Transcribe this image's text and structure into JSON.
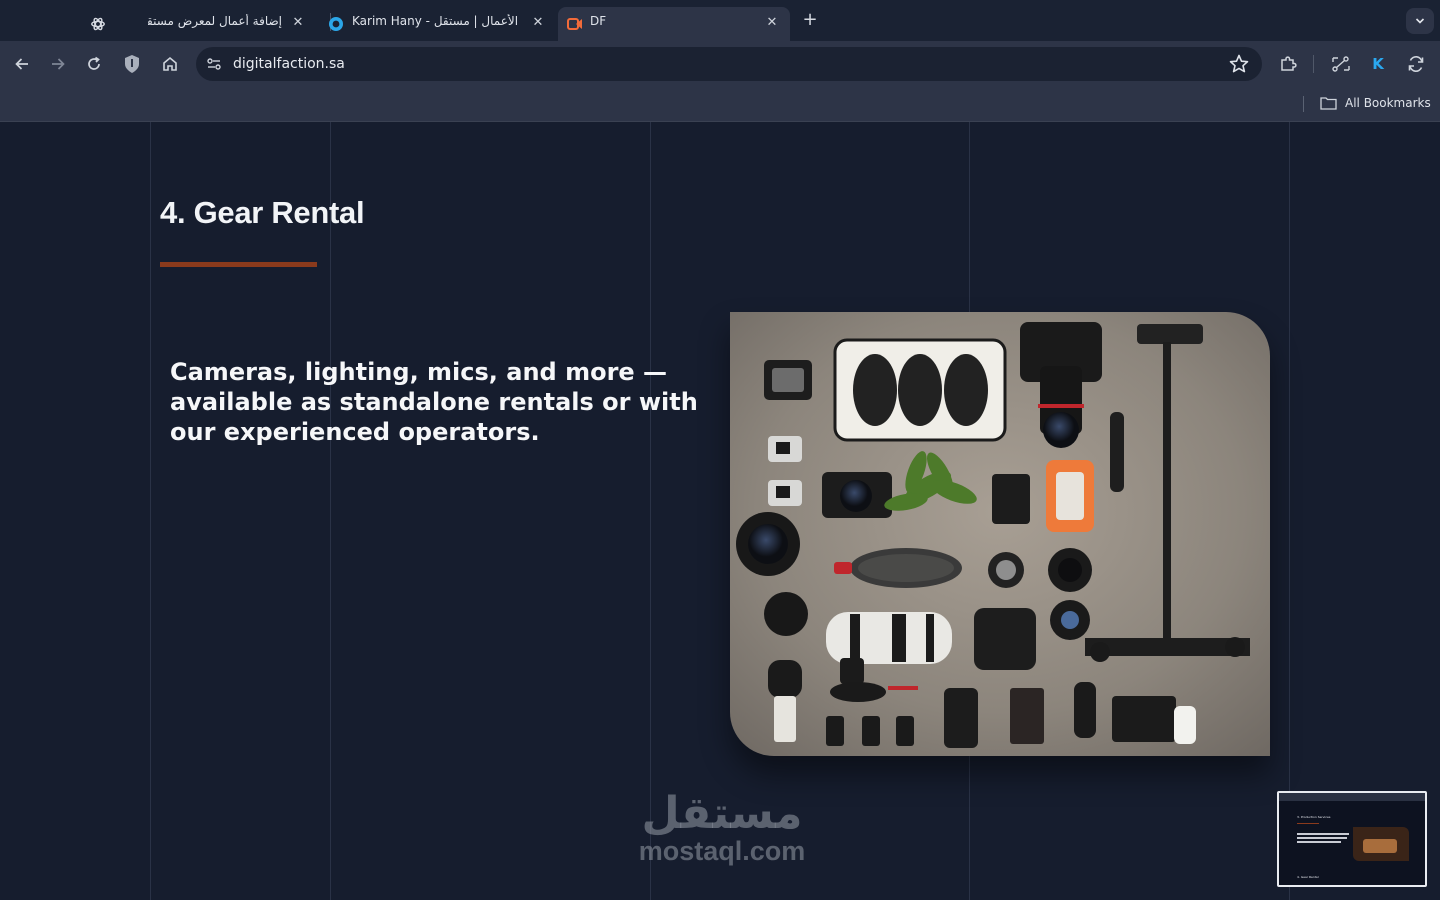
{
  "browser": {
    "tabs": [
      {
        "title": "",
        "icon": "openai-icon"
      },
      {
        "title": "إضافة أعمال لمعرض مستقل",
        "icon": "none"
      },
      {
        "title": "Karim Hany - معرض الأعمال | مستقل",
        "icon": "mostaql-icon"
      },
      {
        "title": "DF",
        "icon": "df-icon",
        "active": true
      }
    ],
    "url": "digitalfaction.sa",
    "bookmarks_label": "All Bookmarks",
    "profile_initial": "K"
  },
  "page": {
    "section_title": "4. Gear Rental",
    "description": "Cameras, lighting, mics, and more — available as standalone rentals or with our experienced operators.",
    "watermark_ar": "مستقل",
    "watermark_en": "mostaql.com",
    "accent_color": "#8a3a1c"
  },
  "thumbnail": {
    "heading": "3. Production Services",
    "footer": "4. Gear Rental"
  }
}
